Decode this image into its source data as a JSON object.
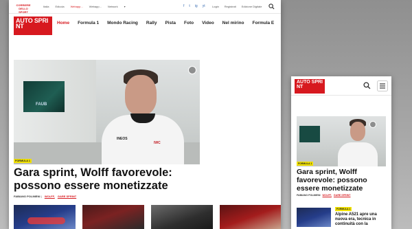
{
  "desktop": {
    "topbar": {
      "mini_logo": "CORRIERE DELLO SPORT",
      "links": [
        "Italia",
        "Edicola",
        "Webapp...",
        "Webapp...",
        "Network"
      ],
      "active_index": 2,
      "social": [
        "f",
        "t",
        "ig",
        "yt"
      ],
      "login": "Login",
      "register": "Registrati",
      "edition": "Edizione Digitale"
    },
    "nav": {
      "logo": "AUTO SPRI NT",
      "items": [
        "Home",
        "Formula 1",
        "Mondo Racing",
        "Rally",
        "Pista",
        "Foto",
        "Video",
        "Nel mirino",
        "Formula E"
      ],
      "active_index": 0
    },
    "hero": {
      "screen_text": "FAUB",
      "sponsor1": "INEOS",
      "sponsor2": "IWC"
    },
    "article": {
      "category": "FORMULA 1",
      "headline": "Gara sprint, Wolff favorevole: possono essere monetizzate",
      "author": "FABIANO POLIMENI",
      "tags": [
        "WOLFF,",
        "GARE SPRINT"
      ]
    }
  },
  "mobile": {
    "logo": "AUTO SPRI NT",
    "article": {
      "category": "FORMULA 1",
      "headline": "Gara sprint, Wolff favorevole: possono essere monetizzate",
      "author": "FABIANO POLIMENI",
      "tags": [
        "WOLFF,",
        "GARE SPRINT"
      ]
    },
    "second_article": {
      "category": "FORMULA 1",
      "headline": "Alpine A521 apre una nuova era, tecnica in continuità con la"
    }
  },
  "colors": {
    "brand_red": "#d7191f",
    "tag_yellow": "#f2e200",
    "background": "#a6a6a6"
  }
}
